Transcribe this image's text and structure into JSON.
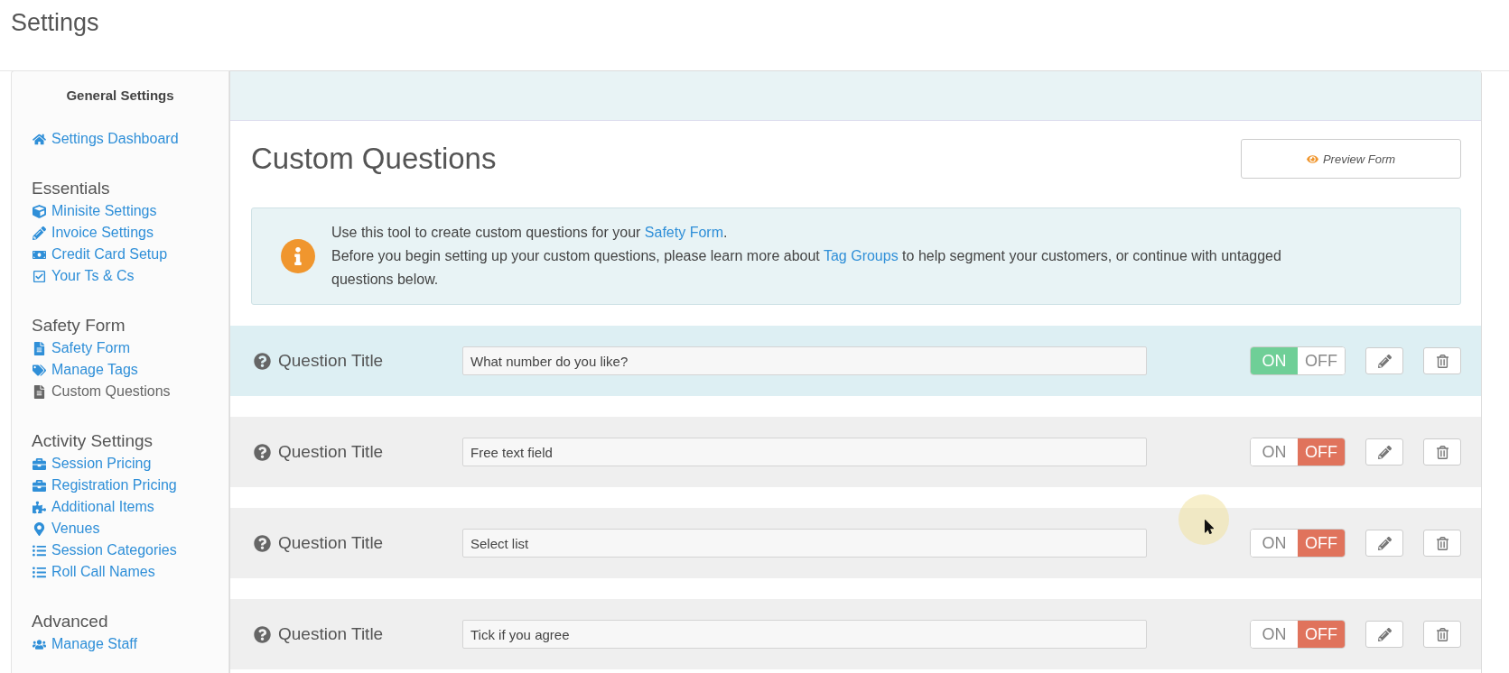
{
  "page_title": "Settings",
  "sidebar": {
    "title": "General Settings",
    "top_items": [
      {
        "label": "Settings Dashboard",
        "kind": "home",
        "selected": false
      }
    ],
    "sections": [
      {
        "heading": "Essentials",
        "items": [
          {
            "label": "Minisite Settings",
            "kind": "cube",
            "selected": false
          },
          {
            "label": "Invoice Settings",
            "kind": "pencil",
            "selected": false
          },
          {
            "label": "Credit Card Setup",
            "kind": "money",
            "selected": false
          },
          {
            "label": "Your Ts & Cs",
            "kind": "check",
            "selected": false
          }
        ]
      },
      {
        "heading": "Safety Form",
        "items": [
          {
            "label": "Safety Form",
            "kind": "file",
            "selected": false
          },
          {
            "label": "Manage Tags",
            "kind": "tags",
            "selected": false
          },
          {
            "label": "Custom Questions",
            "kind": "file",
            "selected": true
          }
        ]
      },
      {
        "heading": "Activity Settings",
        "items": [
          {
            "label": "Session Pricing",
            "kind": "briefcase",
            "selected": false
          },
          {
            "label": "Registration Pricing",
            "kind": "briefcase",
            "selected": false
          },
          {
            "label": "Additional Items",
            "kind": "puzzle",
            "selected": false
          },
          {
            "label": "Venues",
            "kind": "marker",
            "selected": false
          },
          {
            "label": "Session Categories",
            "kind": "list",
            "selected": false
          },
          {
            "label": "Roll Call Names",
            "kind": "list",
            "selected": false
          }
        ]
      },
      {
        "heading": "Advanced",
        "items": [
          {
            "label": "Manage Staff",
            "kind": "users",
            "selected": false
          }
        ]
      }
    ]
  },
  "main": {
    "heading": "Custom Questions",
    "preview_button": "Preview Form",
    "info": {
      "lines": [
        [
          {
            "kind": "text",
            "text": "Use this tool to create custom questions for your "
          },
          {
            "kind": "link",
            "text": "Safety Form"
          },
          {
            "kind": "text",
            "text": "."
          }
        ],
        [
          {
            "kind": "text",
            "text": "Before you begin setting up your custom questions, please learn more about "
          },
          {
            "kind": "link",
            "text": "Tag Groups"
          },
          {
            "kind": "text",
            "text": " to help segment your customers, or continue with untagged questions below."
          }
        ]
      ]
    },
    "questions": [
      {
        "label": "Question Title",
        "value": "What number do you like?",
        "selected": true,
        "on": true,
        "on_label": "ON",
        "off_label": "OFF"
      },
      {
        "label": "Question Title",
        "value": "Free text field",
        "selected": false,
        "on": false,
        "on_label": "ON",
        "off_label": "OFF"
      },
      {
        "label": "Question Title",
        "value": "Select list",
        "selected": false,
        "on": false,
        "on_label": "ON",
        "off_label": "OFF"
      },
      {
        "label": "Question Title",
        "value": "Tick if you agree",
        "selected": false,
        "on": false,
        "on_label": "ON",
        "off_label": "OFF"
      }
    ]
  }
}
